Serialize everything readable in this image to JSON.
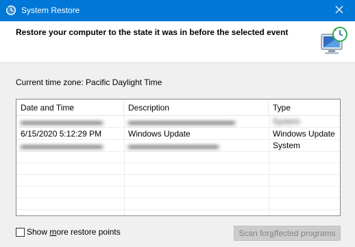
{
  "window": {
    "title": "System Restore",
    "close_icon": "close-icon"
  },
  "header": {
    "title": "Restore your computer to the state it was in before the selected event",
    "icon": "system-restore-icon"
  },
  "timezone": "Current time zone: Pacific Daylight Time",
  "table": {
    "columns": [
      "Date and Time",
      "Description",
      "Type"
    ],
    "rows": [
      {
        "date": "",
        "description": "",
        "type": "System"
      },
      {
        "date": "6/15/2020 5:12:29 PM",
        "description": "Windows Update",
        "type": "Windows Update"
      },
      {
        "date": "",
        "description": "",
        "type": "System"
      }
    ]
  },
  "show_more": {
    "label_pre": "Show ",
    "label_accel": "m",
    "label_post": "ore restore points",
    "checked": false
  },
  "scan_button": {
    "label_pre": "Scan for ",
    "label_accel": "a",
    "label_post": "ffected programs",
    "enabled": false
  },
  "colors": {
    "titlebar": "#0078d7",
    "header_bg": "#ffffff",
    "window_bg": "#f0f0f0"
  }
}
